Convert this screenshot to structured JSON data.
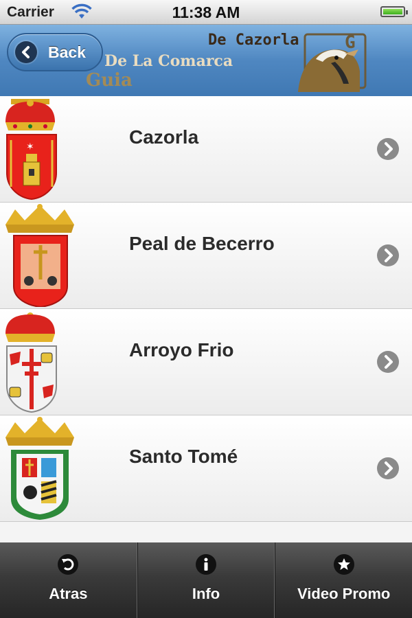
{
  "status_bar": {
    "carrier": "Carrier",
    "time": "11:38 AM"
  },
  "header": {
    "back_label": "Back",
    "logo_text_1": "De Cazorla",
    "logo_text_2": "De La Comarca",
    "logo_text_3": "Guia"
  },
  "list": {
    "items": [
      {
        "label": "Cazorla",
        "icon": "cazorla-coat-of-arms-icon"
      },
      {
        "label": "Peal de Becerro",
        "icon": "peal-de-becerro-coat-of-arms-icon"
      },
      {
        "label": "Arroyo Frio",
        "icon": "arroyo-frio-coat-of-arms-icon"
      },
      {
        "label": "Santo Tomé",
        "icon": "santo-tome-coat-of-arms-icon"
      }
    ]
  },
  "tabbar": {
    "tabs": [
      {
        "label": "Atras",
        "icon": "undo-arrow-icon"
      },
      {
        "label": "Info",
        "icon": "info-icon"
      },
      {
        "label": "Video Promo",
        "icon": "star-icon"
      }
    ]
  },
  "colors": {
    "header_blue": "#4f87c1",
    "tabbar_dark": "#2e2e2e",
    "chevron_gray": "#8a8a8a"
  }
}
